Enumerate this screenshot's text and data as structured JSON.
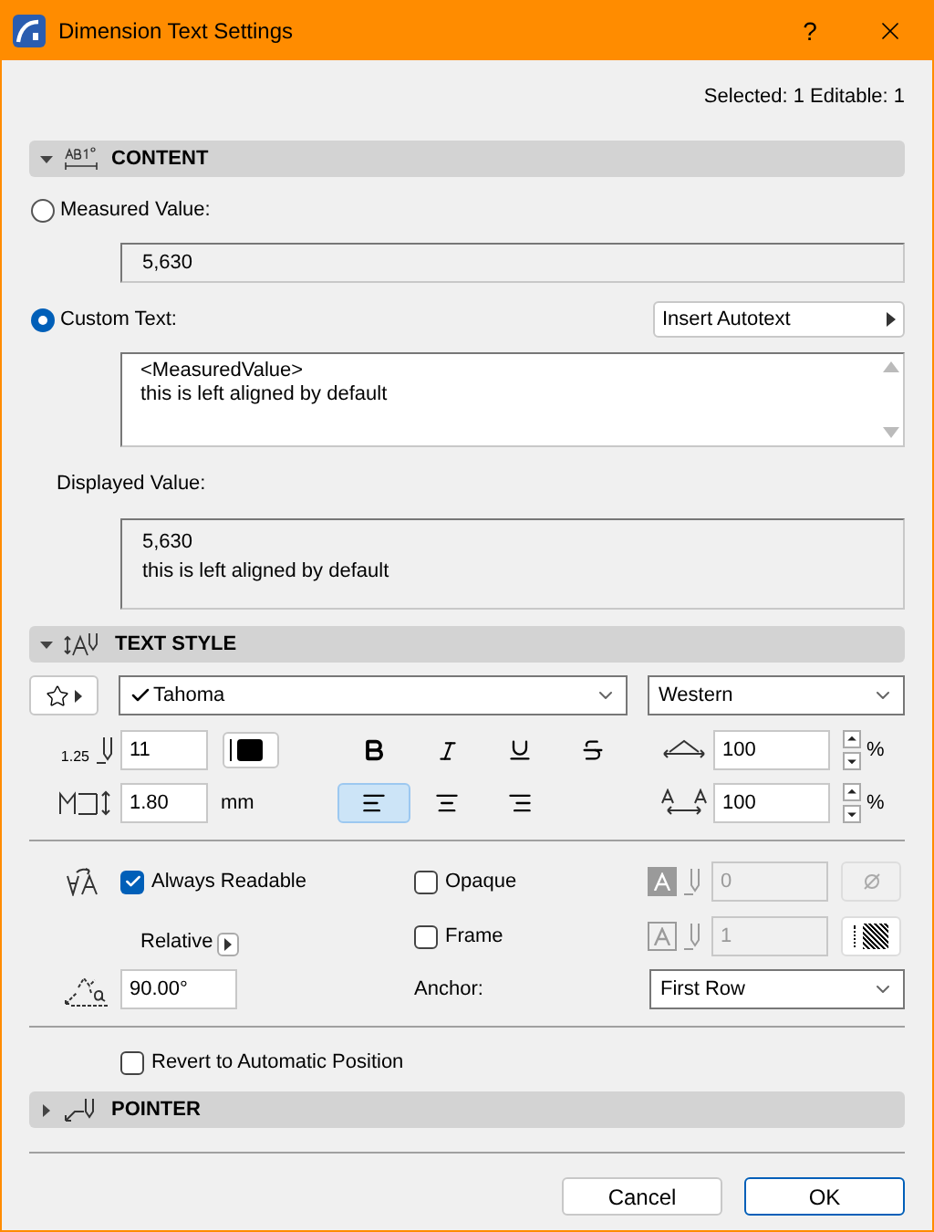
{
  "window": {
    "title": "Dimension Text Settings",
    "help": "?"
  },
  "selection_info": "Selected: 1 Editable: 1",
  "content_section": {
    "title": "CONTENT",
    "expanded": true,
    "measured_value": {
      "label": "Measured Value:",
      "selected": false,
      "value": "5,630"
    },
    "custom_text": {
      "label": "Custom Text:",
      "selected": true,
      "lines": [
        "<MeasuredValue>",
        "this is left aligned by default"
      ]
    },
    "insert_autotext_button": "Insert Autotext",
    "displayed_value": {
      "label": "Displayed Value:",
      "lines": [
        "5,630",
        "this is left aligned by default"
      ]
    }
  },
  "text_style_section": {
    "title": "TEXT STYLE",
    "expanded": true,
    "font": "Tahoma",
    "script": "Western",
    "size": {
      "icon_text": "1.25",
      "value": "11"
    },
    "styles": [
      {
        "kind": "bold",
        "selected": false
      },
      {
        "kind": "italic",
        "selected": false
      },
      {
        "kind": "underline",
        "selected": false
      },
      {
        "kind": "strikethrough",
        "selected": false
      }
    ],
    "line_spacing": {
      "value": "1.80",
      "unit": "mm"
    },
    "alignments": [
      {
        "kind": "left",
        "selected": true
      },
      {
        "kind": "center",
        "selected": false
      },
      {
        "kind": "right",
        "selected": false
      }
    ],
    "width_factor": {
      "value": "100",
      "unit": "%"
    },
    "char_spacing": {
      "value": "100",
      "unit": "%"
    },
    "always_readable": {
      "label": "Always Readable",
      "checked": true
    },
    "opaque": {
      "label": "Opaque",
      "checked": false,
      "pen": "0",
      "disabled": true
    },
    "frame": {
      "label": "Frame",
      "checked": false,
      "pen": "1",
      "disabled": true
    },
    "rotation": {
      "mode": "Relative",
      "value": "90.00°"
    },
    "anchor": {
      "label": "Anchor:",
      "value": "First Row"
    }
  },
  "revert": {
    "label": "Revert to Automatic Position",
    "checked": false
  },
  "pointer_section": {
    "title": "POINTER",
    "expanded": false
  },
  "buttons": [
    {
      "label": "Cancel",
      "kind": "secondary"
    },
    {
      "label": "OK",
      "kind": "primary"
    }
  ]
}
